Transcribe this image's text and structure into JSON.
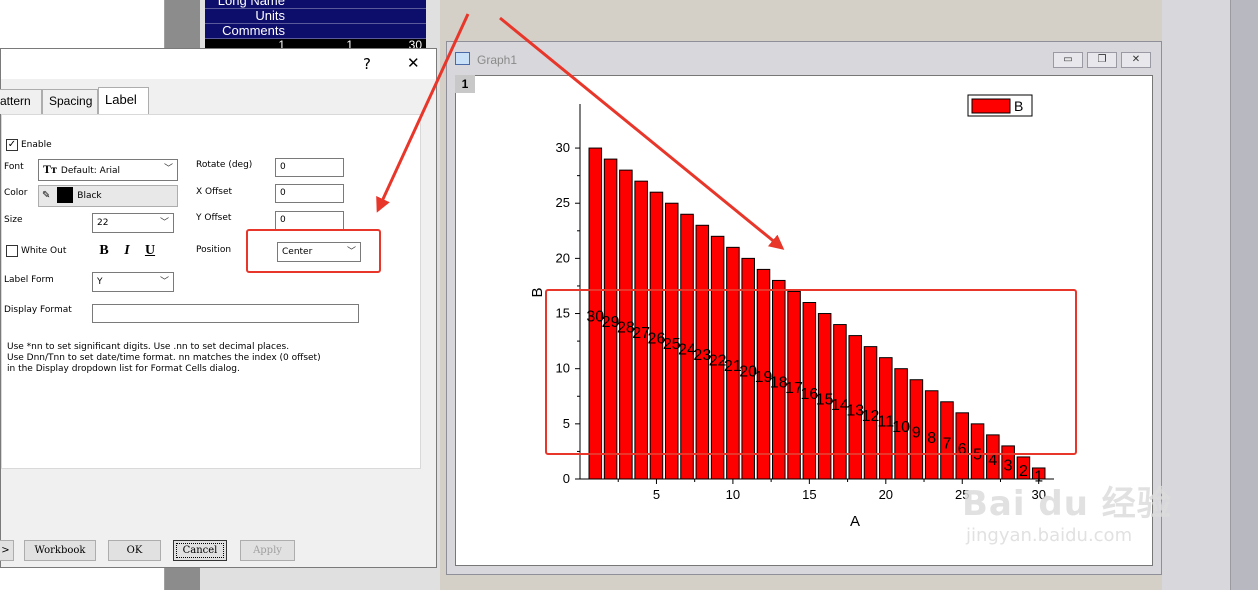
{
  "workbook": {
    "rows": [
      {
        "label": "Long Name",
        "value": ""
      },
      {
        "label": "Units",
        "value": ""
      },
      {
        "label": "Comments",
        "value": ""
      }
    ],
    "first_row": {
      "index": "1",
      "a": "1",
      "b": "30"
    }
  },
  "dialog": {
    "help_label": "?",
    "close_label": "✕",
    "tabs": [
      {
        "label": "attern"
      },
      {
        "label": "Spacing"
      },
      {
        "label": "Label",
        "active": true
      }
    ],
    "enable": {
      "label": "Enable",
      "checked": true
    },
    "font": {
      "label": "Font",
      "value": "Default: Arial"
    },
    "color": {
      "label": "Color",
      "value": "Black"
    },
    "size": {
      "label": "Size",
      "value": "22"
    },
    "white_out": {
      "label": "White Out",
      "checked": false
    },
    "bold_label": "B",
    "italic_label": "I",
    "underline_label": "U",
    "label_form": {
      "label": "Label Form",
      "value": "Y"
    },
    "rotate": {
      "label": "Rotate (deg)",
      "value": "0"
    },
    "x_offset": {
      "label": "X Offset",
      "value": "0"
    },
    "y_offset": {
      "label": "Y Offset",
      "value": "0"
    },
    "position": {
      "label": "Position",
      "value": "Center"
    },
    "display_format": {
      "label": "Display Format",
      "value": ""
    },
    "help_text": [
      "Use *nn to set significant digits. Use .nn to set decimal places.",
      "Use Dnn/Tnn to set date/time format. nn matches the index (0 offset)",
      "in the Display dropdown list for Format Cells dialog."
    ],
    "buttons": {
      "arrow": ">",
      "workbook": "Workbook",
      "ok": "OK",
      "cancel": "Cancel",
      "apply": "Apply"
    }
  },
  "graph_window": {
    "title": "Graph1",
    "layer_label": "1"
  },
  "watermark": {
    "brand": "Bai du 经验",
    "url": "jingyan.baidu.com"
  },
  "colors": {
    "bar": "#ff0000",
    "annotation": "#e8362a",
    "sheet_header": "#0d0d6b"
  },
  "chart_data": {
    "type": "bar",
    "x": [
      1,
      2,
      3,
      4,
      5,
      6,
      7,
      8,
      9,
      10,
      11,
      12,
      13,
      14,
      15,
      16,
      17,
      18,
      19,
      20,
      21,
      22,
      23,
      24,
      25,
      26,
      27,
      28,
      29,
      30
    ],
    "values": [
      30,
      29,
      28,
      27,
      26,
      25,
      24,
      23,
      22,
      21,
      20,
      19,
      18,
      17,
      16,
      15,
      14,
      13,
      12,
      11,
      10,
      9,
      8,
      7,
      6,
      5,
      4,
      3,
      2,
      1
    ],
    "data_labels": [
      "30",
      "29",
      "28",
      "27",
      "26",
      "25",
      "24",
      "23",
      "22",
      "21",
      "20",
      "19",
      "18",
      "17",
      "16",
      "15",
      "14",
      "13",
      "12",
      "11",
      "10",
      "9",
      "8",
      "7",
      "6",
      "5",
      "4",
      "3",
      "2",
      "1"
    ],
    "xlabel": "A",
    "ylabel": "B",
    "xticks": [
      "5",
      "10",
      "15",
      "20",
      "25",
      "30"
    ],
    "yticks": [
      "0",
      "5",
      "10",
      "15",
      "20",
      "25",
      "30"
    ],
    "xlim": [
      0,
      31
    ],
    "ylim": [
      0,
      32
    ],
    "legend": [
      {
        "name": "B"
      }
    ],
    "legend_position": "top-right",
    "label_position": "center"
  }
}
